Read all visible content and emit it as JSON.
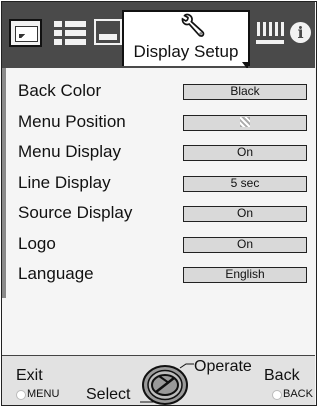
{
  "tabs": {
    "active_label": "Display Setup",
    "icons": [
      "picture-icon",
      "list-settings-icon",
      "window-icon",
      "wrench-icon",
      "language-icon",
      "info-icon"
    ]
  },
  "menu": {
    "items": [
      {
        "label": "Back Color",
        "value": "Black"
      },
      {
        "label": "Menu Position",
        "value": ""
      },
      {
        "label": "Menu Display",
        "value": "On"
      },
      {
        "label": "Line Display",
        "value": "5 sec"
      },
      {
        "label": "Source Display",
        "value": "On"
      },
      {
        "label": "Logo",
        "value": "On"
      },
      {
        "label": "Language",
        "value": "English"
      }
    ]
  },
  "footer": {
    "exit_label": "Exit",
    "menu_key": "MENU",
    "select_label": "Select",
    "operate_label": "Operate",
    "back_label": "Back",
    "back_key": "BACK"
  }
}
